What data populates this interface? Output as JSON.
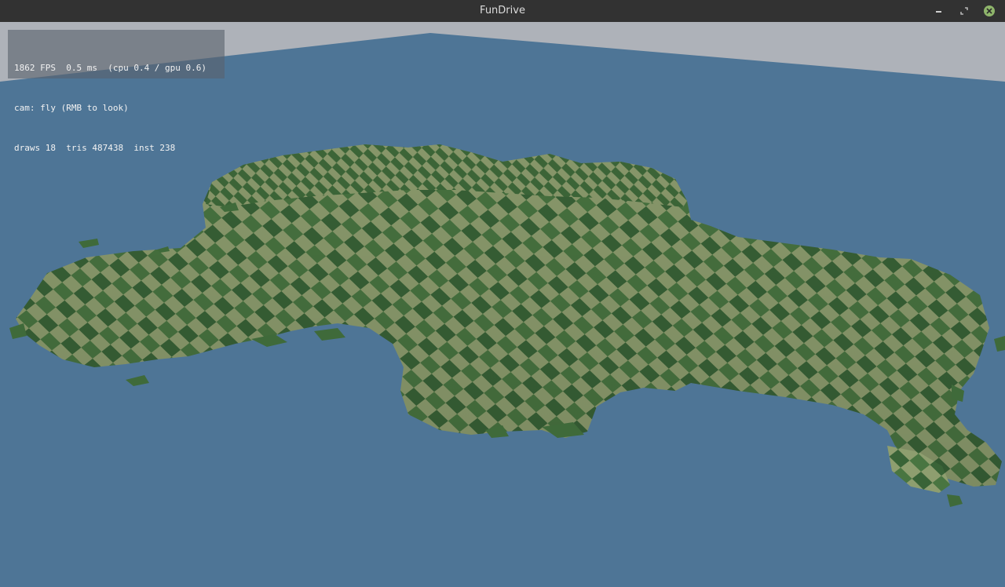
{
  "window": {
    "title": "FunDrive",
    "controls": {
      "minimize_icon": "minimize-icon",
      "restore_icon": "restore-icon",
      "close_icon": "close-icon"
    }
  },
  "hud": {
    "line1": "1862 FPS  0.5 ms  (cpu 0.4 / gpu 0.6)",
    "line2": "cam: fly (RMB to look)",
    "line3": "draws 18  tris 487438  inst 238"
  },
  "colors": {
    "sky": "#aeb2b9",
    "water": "#4e7596",
    "terrain_light": "#8e9e6f",
    "terrain_grass": "#3f6a3a",
    "titlebar": "#323232",
    "close_button": "#8fb56b"
  }
}
